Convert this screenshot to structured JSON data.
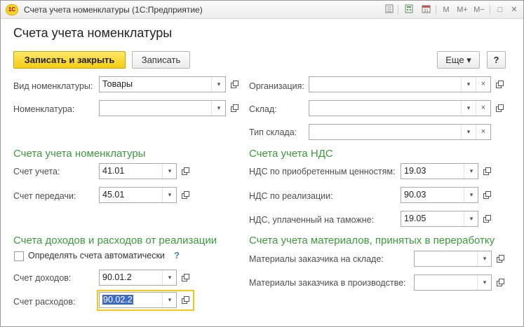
{
  "window": {
    "logo": "1С",
    "title": "Счета учета номенклатуры  (1С:Предприятие)",
    "icons": [
      "doc-icon",
      "calculator-icon",
      "calendar-icon",
      "memory-m-icon",
      "memory-plus-icon",
      "memory-minus-icon",
      "maximize-icon",
      "close-icon"
    ],
    "m": "M",
    "m_plus": "M+",
    "m_minus": "M−",
    "maximize": "□",
    "close": "✕"
  },
  "form": {
    "title": "Счета учета номенклатуры"
  },
  "toolbar": {
    "save_close_label": "Записать и закрыть",
    "save_label": "Записать",
    "more_label": "Еще ▾",
    "help_label": "?"
  },
  "top_fields": {
    "item_kind": {
      "label": "Вид номенклатуры:",
      "value": "Товары"
    },
    "item": {
      "label": "Номенклатура:",
      "value": ""
    },
    "organization": {
      "label": "Организация:",
      "value": ""
    },
    "warehouse": {
      "label": "Склад:",
      "value": ""
    },
    "warehouse_type": {
      "label": "Тип склада:",
      "value": ""
    }
  },
  "sections": {
    "item_accounts": {
      "title": "Счета учета номенклатуры",
      "account": {
        "label": "Счет учета:",
        "value": "41.01"
      },
      "transfer": {
        "label": "Счет передачи:",
        "value": "45.01"
      }
    },
    "vat_accounts": {
      "title": "Счета учета НДС",
      "purchased": {
        "label": "НДС по приобретенным ценностям:",
        "value": "19.03"
      },
      "sales": {
        "label": "НДС по реализации:",
        "value": "90.03"
      },
      "customs": {
        "label": "НДС, уплаченный на таможне:",
        "value": "19.05"
      }
    },
    "income_expense": {
      "title": "Счета доходов и расходов от реализации",
      "auto_checkbox_label": "Определять счета автоматически",
      "auto_checked": false,
      "help": "?",
      "income": {
        "label": "Счет доходов:",
        "value": "90.01.2"
      },
      "expense": {
        "label": "Счет расходов:",
        "value": "90.02.2"
      }
    },
    "materials": {
      "title": "Счета учета материалов, принятых в переработку",
      "at_warehouse": {
        "label": "Материалы заказчика на складе:",
        "value": ""
      },
      "in_production": {
        "label": "Материалы заказчика в производстве:",
        "value": ""
      }
    }
  },
  "glyphs": {
    "dropdown": "▾",
    "clear": "×"
  },
  "colors": {
    "section": "#3c9a3c",
    "primary_button": "#f4cd15",
    "focus_border": "#f5c518",
    "selection": "#3d6ac7"
  }
}
